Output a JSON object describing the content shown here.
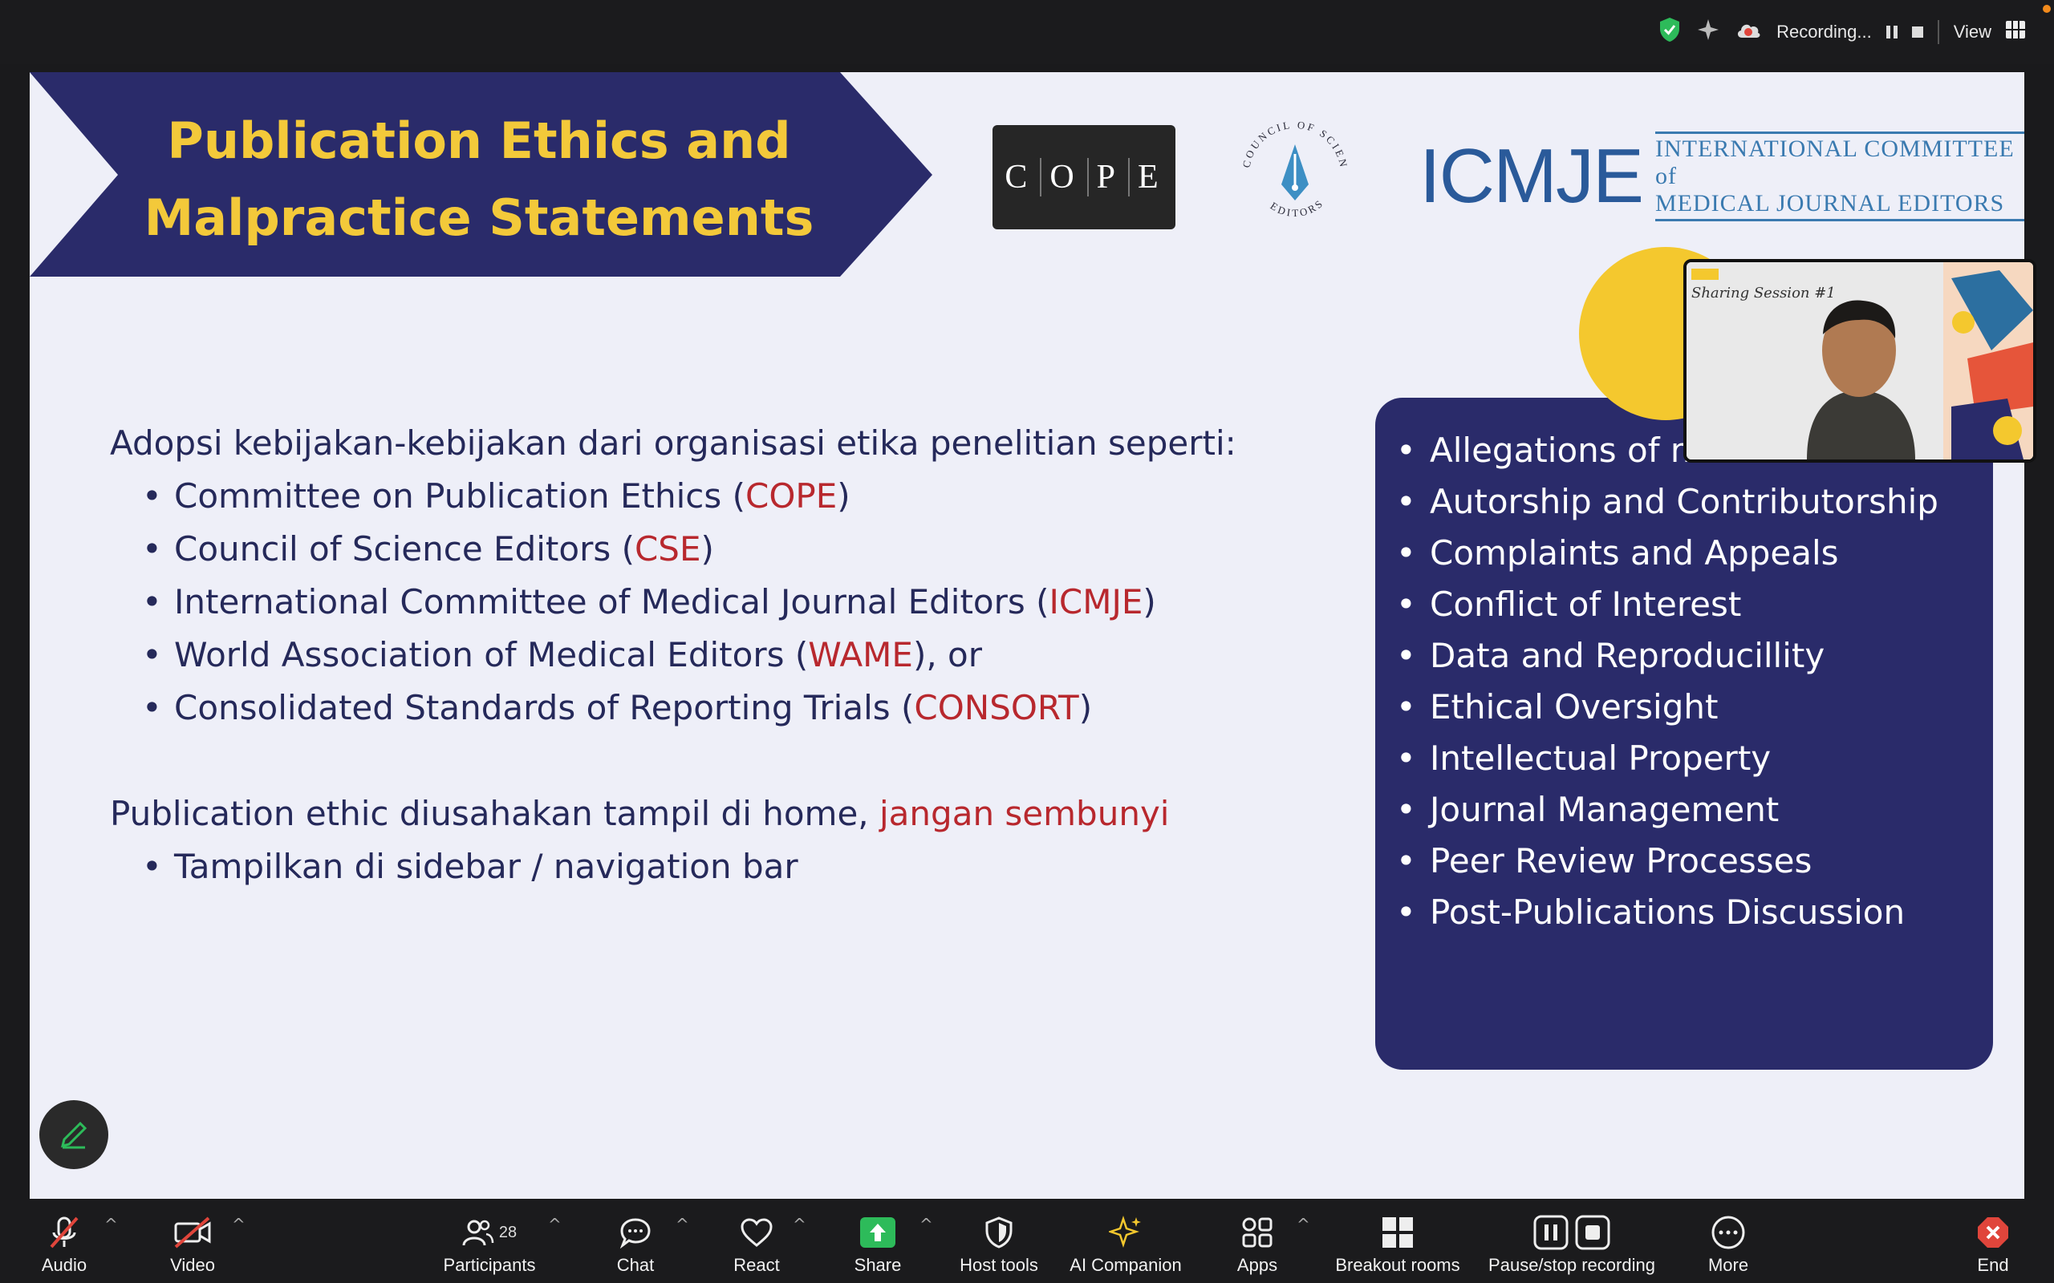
{
  "topbar": {
    "recording_label": "Recording...",
    "view_label": "View"
  },
  "slide": {
    "title_line1": "Publication Ethics and",
    "title_line2": "Malpractice Statements",
    "cope_logo_text": [
      "C",
      "O",
      "P",
      "E"
    ],
    "cse_logo_text_top": "COUNCIL OF SCIENCE",
    "cse_logo_text_bottom": "EDITORS",
    "icmje_abbrev": "ICMJE",
    "icmje_line1": "INTERNATIONAL COMMITTEE of",
    "icmje_line2": "MEDICAL JOURNAL EDITORS",
    "intro": "Adopsi kebijakan-kebijakan dari organisasi etika penelitian seperti:",
    "orgs": [
      {
        "pre": "Committee on Publication Ethics (",
        "abbr": "COPE",
        "post": ")"
      },
      {
        "pre": "Council of Science Editors (",
        "abbr": "CSE",
        "post": ")"
      },
      {
        "pre": "International Committee of Medical Journal Editors (",
        "abbr": "ICMJE",
        "post": ")"
      },
      {
        "pre": "World Association of Medical Editors (",
        "abbr": "WAME",
        "post": "), or"
      },
      {
        "pre": "Consolidated Standards of Reporting Trials (",
        "abbr": "CONSORT",
        "post": ")"
      }
    ],
    "home_pre": "Publication ethic diusahakan tampil di home, ",
    "home_red": "jangan sembunyi",
    "home_bullet": "Tampilkan di sidebar / navigation bar",
    "topics": [
      "Allegations of misconduct",
      "Autorship and Contributorship",
      "Complaints and Appeals",
      "Conflict of Interest",
      "Data and Reproducillity",
      "Ethical Oversight",
      "Intellectual Property",
      "Journal Management",
      "Peer Review Processes",
      "Post-Publications Discussion"
    ]
  },
  "video_tile": {
    "caption": "Sharing Session #1"
  },
  "toolbar": {
    "audio": "Audio",
    "video": "Video",
    "participants": "Participants",
    "participants_count": "28",
    "chat": "Chat",
    "react": "React",
    "share": "Share",
    "host_tools": "Host tools",
    "ai_companion": "AI Companion",
    "apps": "Apps",
    "breakout_rooms": "Breakout rooms",
    "pause_stop": "Pause/stop recording",
    "more": "More",
    "end": "End"
  },
  "colors": {
    "banner": "#2a2b6a",
    "title_yellow": "#f3c93a",
    "accent_red": "#b8282e",
    "panel": "#2a2b6a",
    "share_green": "#2dbb5a"
  }
}
